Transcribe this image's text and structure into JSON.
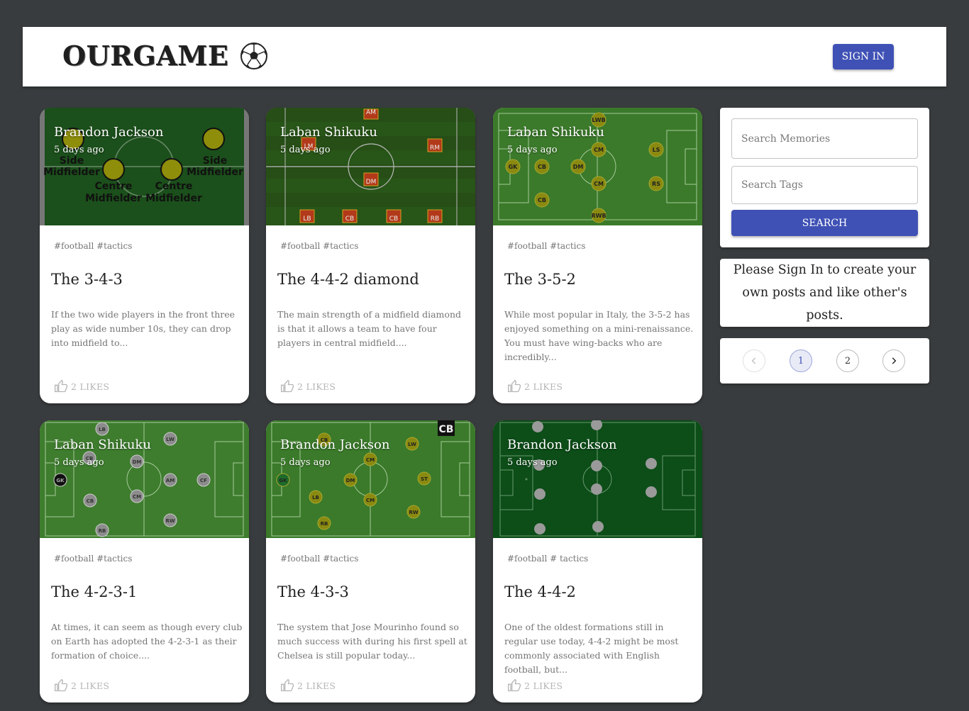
{
  "app": {
    "brand": "OURGAME",
    "brand_icon": "soccer-ball-icon",
    "signin_label": "SIGN IN"
  },
  "posts": [
    {
      "author": "Brandon Jackson",
      "time": "5 days ago",
      "tags": "#football #tactics",
      "title": "The 3-4-3",
      "body": "If the two wide players in the front three play as wide number 10s, they can drop into midfield to...",
      "likes": "2 LIKES",
      "image_text": [
        "Side",
        "Midfielder",
        "Side",
        "Midfielder",
        "Centre",
        "Midfielder",
        "Centre",
        "Midfielder"
      ]
    },
    {
      "author": "Laban Shikuku",
      "time": "5 days ago",
      "tags": "#football #tactics",
      "title": "The 4-4-2 diamond",
      "body": "The main strength of a midfield diamond is that it allows a team to have four players in central midfield....",
      "likes": "2 LIKES",
      "image_text": [
        "AM",
        "LM",
        "RM",
        "DM",
        "LB",
        "CB",
        "CB",
        "RB"
      ]
    },
    {
      "author": "Laban Shikuku",
      "time": "5 days ago",
      "tags": "#football #tactics",
      "title": "The 3-5-2",
      "body": "While most popular in Italy, the 3-5-2 has enjoyed something on a mini-renaissance. You must have wing-backs who are incredibly...",
      "likes": "2 LIKES",
      "image_text": [
        "LWB",
        "GK",
        "CB",
        "CB",
        "DM",
        "CM",
        "CM",
        "RWB",
        "LS",
        "RS"
      ]
    },
    {
      "author": "Laban Shikuku",
      "time": "5 days ago",
      "tags": "#football #tactics",
      "title": "The 4-2-3-1",
      "body": "At times, it can seem as though every club on Earth has adopted the 4-2-3-1 as their formation of choice....",
      "likes": "2 LIKES",
      "image_text": [
        "LB",
        "GK",
        "CB",
        "CB",
        "RB",
        "DM",
        "CM",
        "LW",
        "AM",
        "RW",
        "CF"
      ]
    },
    {
      "author": "Brandon Jackson",
      "time": "5 days ago",
      "tags": "#football #tactics",
      "title": "The 4-3-3",
      "body": "The system that Jose Mourinho found so much success with during his first spell at Chelsea is still popular today...",
      "likes": "2 LIKES",
      "image_text": [
        "CB",
        "LB",
        "GK",
        "CB",
        "RB",
        "DM",
        "CM",
        "CM",
        "LW",
        "ST",
        "RW"
      ]
    },
    {
      "author": "Brandon Jackson",
      "time": "5 days ago",
      "tags": "#football # tactics",
      "title": "The 4-4-2",
      "body": "One of the oldest formations still in regular use today, 4-4-2 might be most commonly associated with English football, but...",
      "likes": "2 LIKES",
      "image_text": []
    }
  ],
  "sidebar": {
    "search_memories_placeholder": "Search Memories",
    "search_tags_placeholder": "Search Tags",
    "search_label": "SEARCH",
    "signin_message": "Please Sign In to create your own posts and like other's posts.",
    "pagination": {
      "pages": [
        "1",
        "2"
      ],
      "current": "1",
      "prev_icon": "chevron-left-icon",
      "next_icon": "chevron-right-icon"
    }
  },
  "colors": {
    "background": "#393c3e",
    "primary": "#3f51b5",
    "card": "#ffffff"
  }
}
